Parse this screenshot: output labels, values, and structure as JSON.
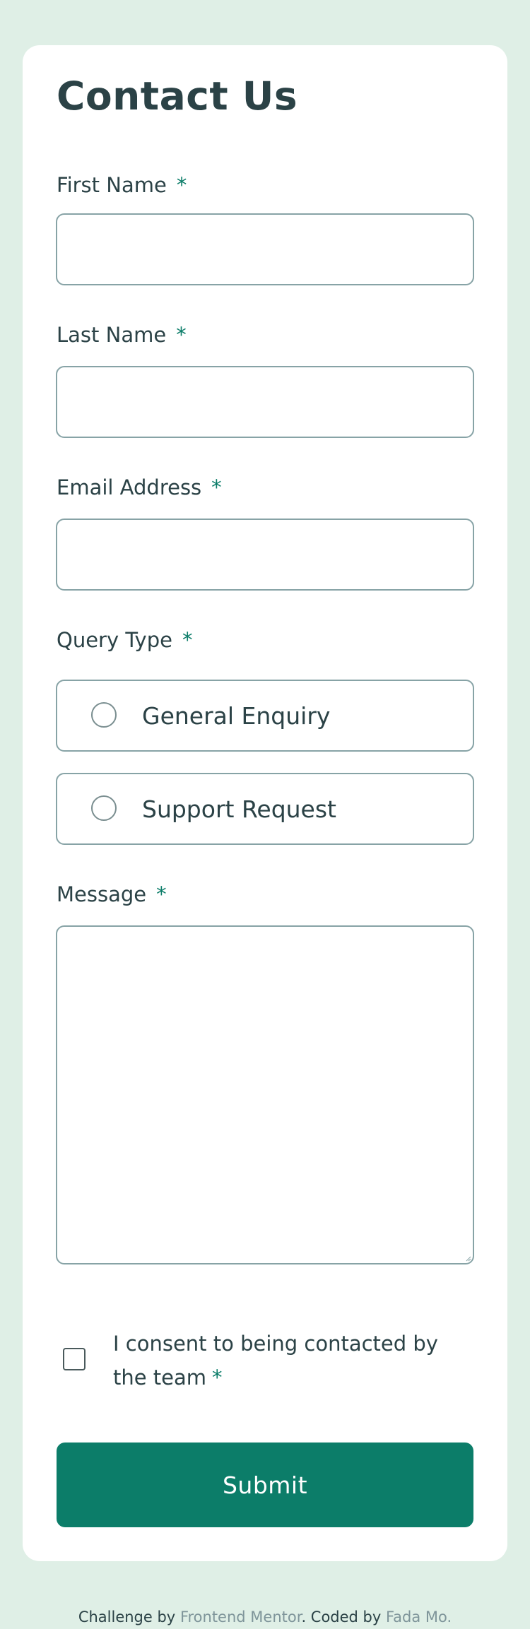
{
  "form": {
    "title": "Contact Us",
    "required_mark": "*",
    "first_name": {
      "label": "First Name",
      "value": ""
    },
    "last_name": {
      "label": "Last Name",
      "value": ""
    },
    "email": {
      "label": "Email Address",
      "value": ""
    },
    "query_type": {
      "label": "Query Type",
      "options": [
        {
          "label": "General Enquiry",
          "selected": false
        },
        {
          "label": "Support Request",
          "selected": false
        }
      ]
    },
    "message": {
      "label": "Message",
      "value": ""
    },
    "consent": {
      "label": "I consent to being contacted by the team",
      "checked": false
    },
    "submit_label": "Submit"
  },
  "footer": {
    "prefix": "Challenge by",
    "challenge_link": "Frontend Mentor",
    "separator": ". Coded by",
    "author_link": "Fada Mo."
  },
  "colors": {
    "background": "#dfefe6",
    "accent": "#0c7d69",
    "text": "#2b4246",
    "border": "#87a3a6",
    "muted_link": "#7f959a"
  }
}
